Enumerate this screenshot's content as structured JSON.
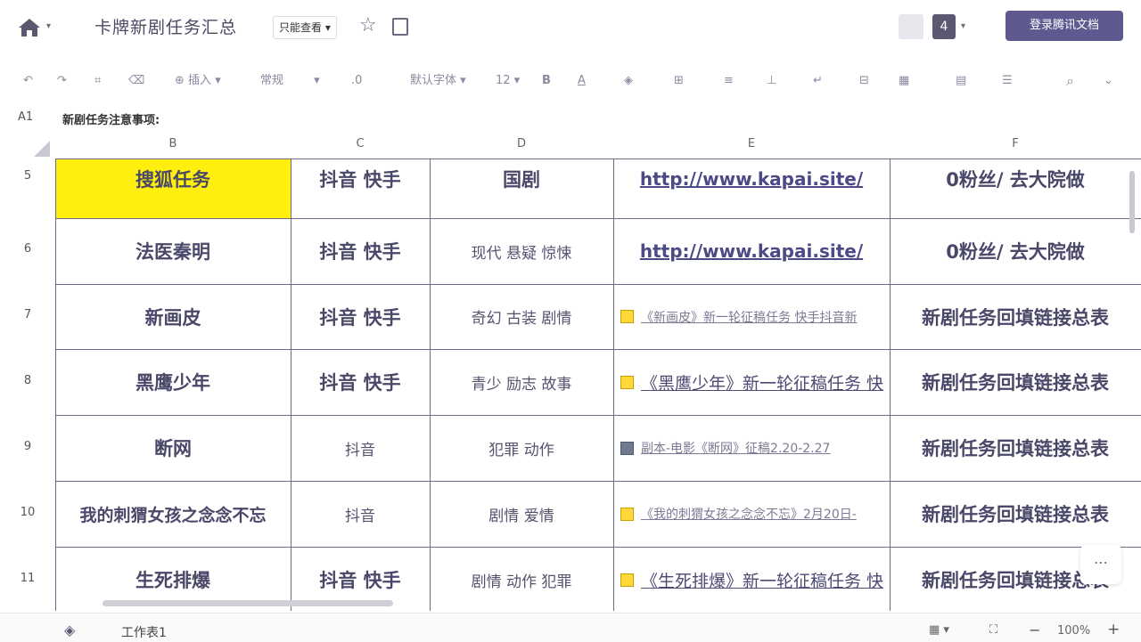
{
  "header": {
    "title": "卡牌新剧任务汇总",
    "mode": "只能查看",
    "collaborator_count": "4",
    "login_label": "登录腾讯文档"
  },
  "toolbar": {
    "insert": "插入",
    "format": "常规",
    "decimal": ".0",
    "font": "默认字体",
    "size": "12",
    "bold": "B",
    "font_color": "A"
  },
  "formula_bar": {
    "cell_ref": "A1",
    "content": "新剧任务注意事项:"
  },
  "columns": [
    "B",
    "C",
    "D",
    "E",
    "F"
  ],
  "rows": [
    {
      "num": "5",
      "b": "搜狐任务",
      "c": "抖音 快手",
      "d": "国剧",
      "e": "http://www.kapai.site/",
      "f": "0粉丝/ 去大院做"
    },
    {
      "num": "6",
      "b": "法医秦明",
      "c": "抖音 快手",
      "d": "现代 悬疑 惊悚",
      "e": "http://www.kapai.site/",
      "f": "0粉丝/ 去大院做"
    },
    {
      "num": "7",
      "b": "新画皮",
      "c": "抖音 快手",
      "d": "奇幻 古装 剧情",
      "e": "《新画皮》新一轮征稿任务 快手抖音新",
      "f": "新剧任务回填链接总表"
    },
    {
      "num": "8",
      "b": "黑鹰少年",
      "c": "抖音 快手",
      "d": "青少 励志 故事",
      "e": "《黑鹰少年》新一轮征稿任务 快",
      "f": "新剧任务回填链接总表"
    },
    {
      "num": "9",
      "b": "断网",
      "c": "抖音",
      "d": "犯罪 动作",
      "e": "副本-电影《断网》征稿2.20-2.27",
      "f": "新剧任务回填链接总表"
    },
    {
      "num": "10",
      "b": "我的刺猬女孩之念念不忘",
      "c": "抖音",
      "d": "剧情 爱情",
      "e": "《我的刺猬女孩之念念不忘》2月20日-",
      "f": "新剧任务回填链接总表"
    },
    {
      "num": "11",
      "b": "生死排爆",
      "c": "抖音 快手",
      "d": "剧情 动作 犯罪",
      "e": "《生死排爆》新一轮征稿任务 快",
      "f": "新剧任务回填链接总表"
    }
  ],
  "bottom": {
    "sheet_tab": "工作表1",
    "zoom": "100%"
  },
  "colors": {
    "highlight": "#ffef0f",
    "accent": "#5e5a8f"
  }
}
